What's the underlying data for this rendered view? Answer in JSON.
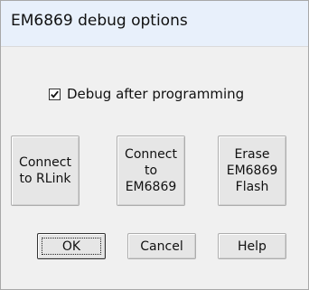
{
  "window": {
    "title": "EM6869 debug options"
  },
  "options": {
    "debug_after_programming_label": "Debug after programming",
    "debug_after_programming_checked": true
  },
  "actions": {
    "connect_rlink_label": "Connect\nto RLink",
    "connect_em6869_label": "Connect\nto\nEM6869",
    "erase_flash_label": "Erase\nEM6869\nFlash"
  },
  "footer": {
    "ok_label": "OK",
    "cancel_label": "Cancel",
    "help_label": "Help"
  },
  "colors": {
    "titlebar_bg": "#e8f0fb",
    "window_bg": "#f0f0f0",
    "button_bg": "#e6e6e6"
  }
}
